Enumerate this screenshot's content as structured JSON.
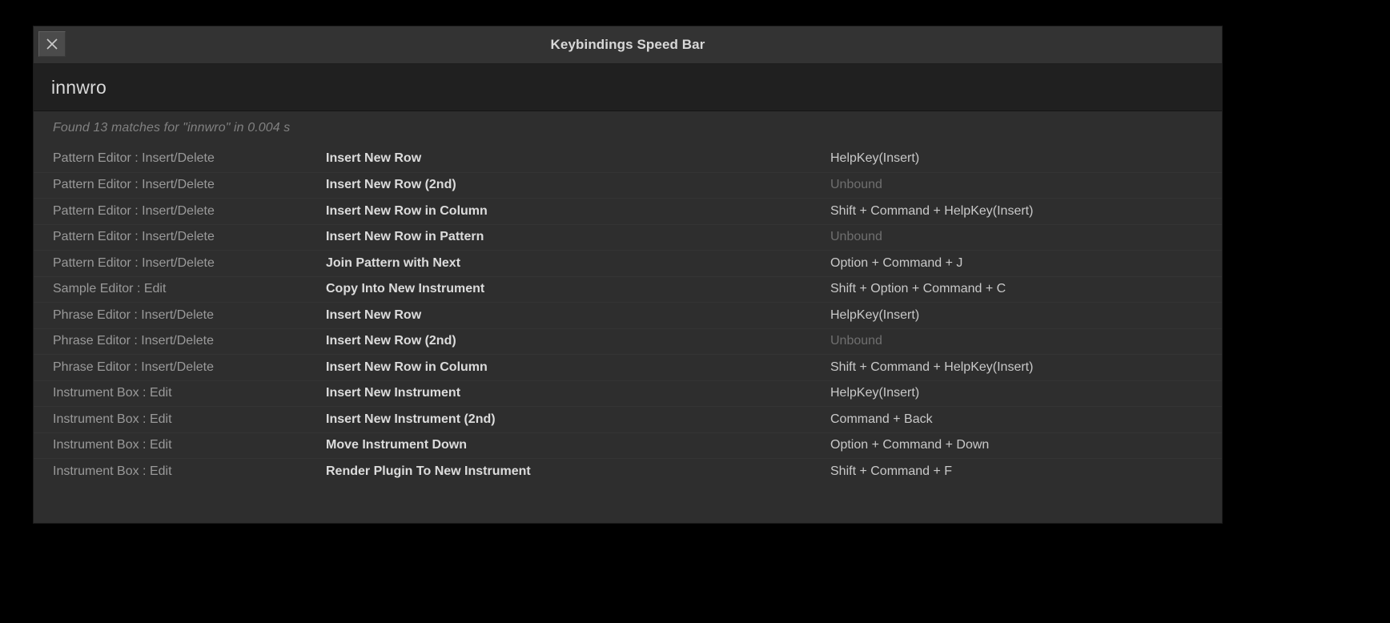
{
  "window": {
    "title": "Keybindings Speed Bar",
    "close_icon": "close-icon"
  },
  "search": {
    "value": "innwro",
    "placeholder": ""
  },
  "status": {
    "text": "Found 13 matches for \"innwro\" in 0.004 s",
    "match_count": 13,
    "query": "innwro",
    "elapsed": "0.004 s"
  },
  "results": {
    "unbound_label": "Unbound",
    "rows": [
      {
        "context": "Pattern Editor : Insert/Delete",
        "action": "Insert New Row",
        "binding": "HelpKey(Insert)",
        "unbound": false
      },
      {
        "context": "Pattern Editor : Insert/Delete",
        "action": "Insert New Row (2nd)",
        "binding": "Unbound",
        "unbound": true
      },
      {
        "context": "Pattern Editor : Insert/Delete",
        "action": "Insert New Row in Column",
        "binding": "Shift + Command + HelpKey(Insert)",
        "unbound": false
      },
      {
        "context": "Pattern Editor : Insert/Delete",
        "action": "Insert New Row in Pattern",
        "binding": "Unbound",
        "unbound": true
      },
      {
        "context": "Pattern Editor : Insert/Delete",
        "action": "Join Pattern with Next",
        "binding": "Option + Command + J",
        "unbound": false
      },
      {
        "context": "Sample Editor : Edit",
        "action": "Copy Into New Instrument",
        "binding": "Shift + Option + Command + C",
        "unbound": false
      },
      {
        "context": "Phrase Editor : Insert/Delete",
        "action": "Insert New Row",
        "binding": "HelpKey(Insert)",
        "unbound": false
      },
      {
        "context": "Phrase Editor : Insert/Delete",
        "action": "Insert New Row (2nd)",
        "binding": "Unbound",
        "unbound": true
      },
      {
        "context": "Phrase Editor : Insert/Delete",
        "action": "Insert New Row in Column",
        "binding": "Shift + Command + HelpKey(Insert)",
        "unbound": false
      },
      {
        "context": "Instrument Box : Edit",
        "action": "Insert New Instrument",
        "binding": "HelpKey(Insert)",
        "unbound": false
      },
      {
        "context": "Instrument Box : Edit",
        "action": "Insert New Instrument (2nd)",
        "binding": "Command + Back",
        "unbound": false
      },
      {
        "context": "Instrument Box : Edit",
        "action": "Move Instrument Down",
        "binding": "Option + Command + Down",
        "unbound": false
      },
      {
        "context": "Instrument Box : Edit",
        "action": "Render Plugin To New Instrument",
        "binding": "Shift + Command + F",
        "unbound": false
      }
    ]
  },
  "colors": {
    "backdrop": "#000000",
    "window_bg": "#2e2e2e",
    "titlebar_bg": "#333333",
    "search_bg": "#202020",
    "text_bright": "#dcdcdc",
    "text_dim": "#9a9a9a",
    "text_unbound": "#6f6f6f",
    "row_separator": "#343434"
  }
}
